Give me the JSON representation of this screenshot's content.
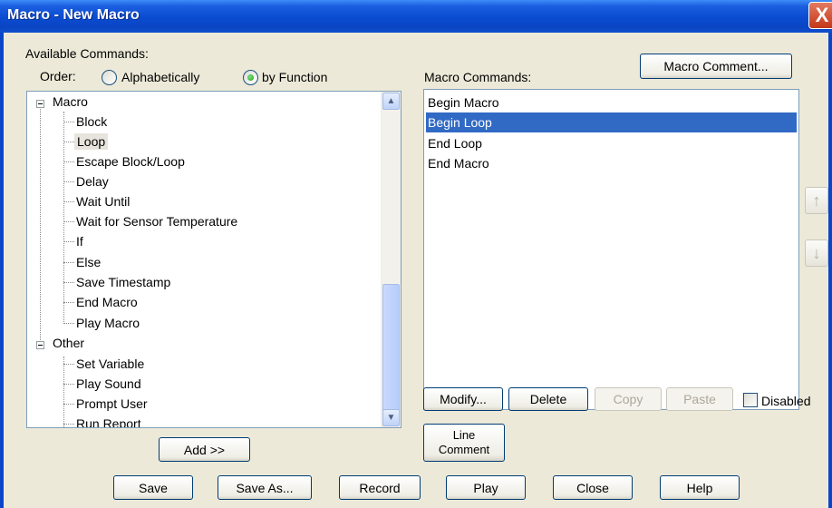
{
  "window": {
    "title": "Macro - New Macro",
    "close_glyph": "X"
  },
  "available": {
    "heading": "Available Commands:",
    "order_label": "Order:",
    "order_options": [
      "Alphabetically",
      "by Function"
    ],
    "order_selected": "by Function"
  },
  "tree": {
    "groups": [
      {
        "label": "Macro",
        "items": [
          "Block",
          "Loop",
          "Escape Block/Loop",
          "Delay",
          "Wait Until",
          "Wait for Sensor Temperature",
          "If",
          "Else",
          "Save Timestamp",
          "End Macro",
          "Play Macro"
        ]
      },
      {
        "label": "Other",
        "items": [
          "Set Variable",
          "Play Sound",
          "Prompt User",
          "Run Report"
        ]
      }
    ],
    "highlighted_item": "Loop"
  },
  "add_button": "Add >>",
  "macro_comment_button": "Macro Comment...",
  "macro_commands": {
    "heading": "Macro Commands:",
    "items": [
      "Begin Macro",
      "Begin Loop",
      "End Loop",
      "End Macro"
    ],
    "selected_item": "Begin Loop"
  },
  "edit_buttons": {
    "modify": "Modify...",
    "delete": "Delete",
    "copy": "Copy",
    "paste": "Paste",
    "disabled_checkbox": "Disabled"
  },
  "line_comment": {
    "line1": "Line",
    "line2": "Comment"
  },
  "bottom_buttons": {
    "save": "Save",
    "save_as": "Save As...",
    "record": "Record",
    "play": "Play",
    "close": "Close",
    "help": "Help"
  },
  "icons": {
    "scroll_up": "up-arrow-icon",
    "scroll_down": "down-arrow-icon",
    "move_up": "move-up-icon",
    "move_down": "move-down-icon"
  },
  "colors": {
    "title_bar": "#0a4bd0",
    "selection": "#316ac5",
    "highlight": "#e6e4dc",
    "window_bg": "#ece9d8"
  }
}
